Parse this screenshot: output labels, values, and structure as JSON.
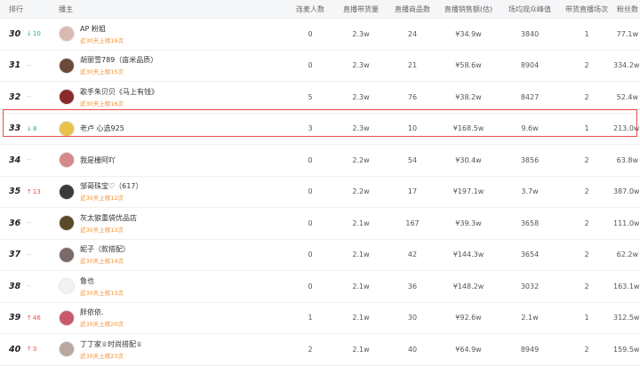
{
  "header": {
    "rank": "排行",
    "anchor": "播主",
    "mic": "连麦人数",
    "live_sales": "直播带货量",
    "products": "直播商品数",
    "sales_amount": "直播销售额(估)",
    "peak_viewers": "场均观众峰值",
    "sessions": "带货直播场次",
    "fans": "粉丝数"
  },
  "rows": [
    {
      "rank": "30",
      "change": "10",
      "dir": "up",
      "name": "AP 粉姐",
      "sub": "近30天上榜19次",
      "mic": "0",
      "sales": "2.3w",
      "products": "24",
      "amount": "¥34.9w",
      "peak": "3840",
      "sessions": "1",
      "fans": "77.1w",
      "avatar_color": "#d9b9b2"
    },
    {
      "rank": "31",
      "change": "--",
      "dir": "same",
      "name": "胡丽雪789（亩米品质）",
      "sub": "近30天上榜15次",
      "mic": "0",
      "sales": "2.3w",
      "products": "21",
      "amount": "¥58.6w",
      "peak": "8904",
      "sessions": "2",
      "fans": "334.2w",
      "avatar_color": "#6b4a3a"
    },
    {
      "rank": "32",
      "change": "--",
      "dir": "same",
      "name": "歌手朱贝贝《马上有钱》",
      "sub": "近30天上榜16次",
      "mic": "5",
      "sales": "2.3w",
      "products": "76",
      "amount": "¥38.2w",
      "peak": "8427",
      "sessions": "2",
      "fans": "52.4w",
      "avatar_color": "#8a2a2a"
    },
    {
      "rank": "33",
      "change": "8",
      "dir": "up",
      "name": "老卢 心选925",
      "sub": "",
      "mic": "3",
      "sales": "2.3w",
      "products": "10",
      "amount": "¥168.5w",
      "peak": "9.6w",
      "sessions": "1",
      "fans": "213.0w",
      "avatar_color": "#e8c24a"
    },
    {
      "rank": "34",
      "change": "--",
      "dir": "same",
      "name": "我是栅阿吖",
      "sub": "",
      "mic": "0",
      "sales": "2.2w",
      "products": "54",
      "amount": "¥30.4w",
      "peak": "3856",
      "sessions": "2",
      "fans": "63.8w",
      "avatar_color": "#d48a8a"
    },
    {
      "rank": "35",
      "change": "13",
      "dir": "down",
      "name": "邹哥珠宝♡（617）",
      "sub": "近30天上榜12次",
      "mic": "0",
      "sales": "2.2w",
      "products": "17",
      "amount": "¥197.1w",
      "peak": "3.7w",
      "sessions": "2",
      "fans": "387.0w",
      "avatar_color": "#3a3a3a"
    },
    {
      "rank": "36",
      "change": "--",
      "dir": "same",
      "name": "灰太狼重袋优品店",
      "sub": "近30天上榜13次",
      "mic": "0",
      "sales": "2.1w",
      "products": "167",
      "amount": "¥39.3w",
      "peak": "3658",
      "sessions": "2",
      "fans": "111.0w",
      "avatar_color": "#5a4a2a"
    },
    {
      "rank": "37",
      "change": "--",
      "dir": "same",
      "name": "妮子（款搭配）",
      "sub": "近30天上榜14次",
      "mic": "0",
      "sales": "2.1w",
      "products": "42",
      "amount": "¥144.3w",
      "peak": "3654",
      "sessions": "2",
      "fans": "62.2w",
      "avatar_color": "#7a6a6a"
    },
    {
      "rank": "38",
      "change": "--",
      "dir": "same",
      "name": "鲁也",
      "sub": "近30天上榜13次",
      "mic": "0",
      "sales": "2.1w",
      "products": "36",
      "amount": "¥148.2w",
      "peak": "3032",
      "sessions": "2",
      "fans": "163.1w",
      "avatar_color": "#f2f2f2"
    },
    {
      "rank": "39",
      "change": "46",
      "dir": "down",
      "name": "胖依依.",
      "sub": "近30天上榜20次",
      "mic": "1",
      "sales": "2.1w",
      "products": "30",
      "amount": "¥92.6w",
      "peak": "2.1w",
      "sessions": "1",
      "fans": "312.5w",
      "avatar_color": "#c85a6a"
    },
    {
      "rank": "40",
      "change": "3",
      "dir": "down",
      "name": "丁丁家♕时尚搭配♕",
      "sub": "近30天上榜23次",
      "mic": "2",
      "sales": "2.1w",
      "products": "40",
      "amount": "¥64.9w",
      "peak": "8949",
      "sessions": "2",
      "fans": "159.5w",
      "avatar_color": "#b8a8a0"
    }
  ],
  "colors": {
    "up": "#21b37a",
    "down": "#f04848",
    "sub": "#f0912f",
    "highlight": "#e64c4c"
  }
}
